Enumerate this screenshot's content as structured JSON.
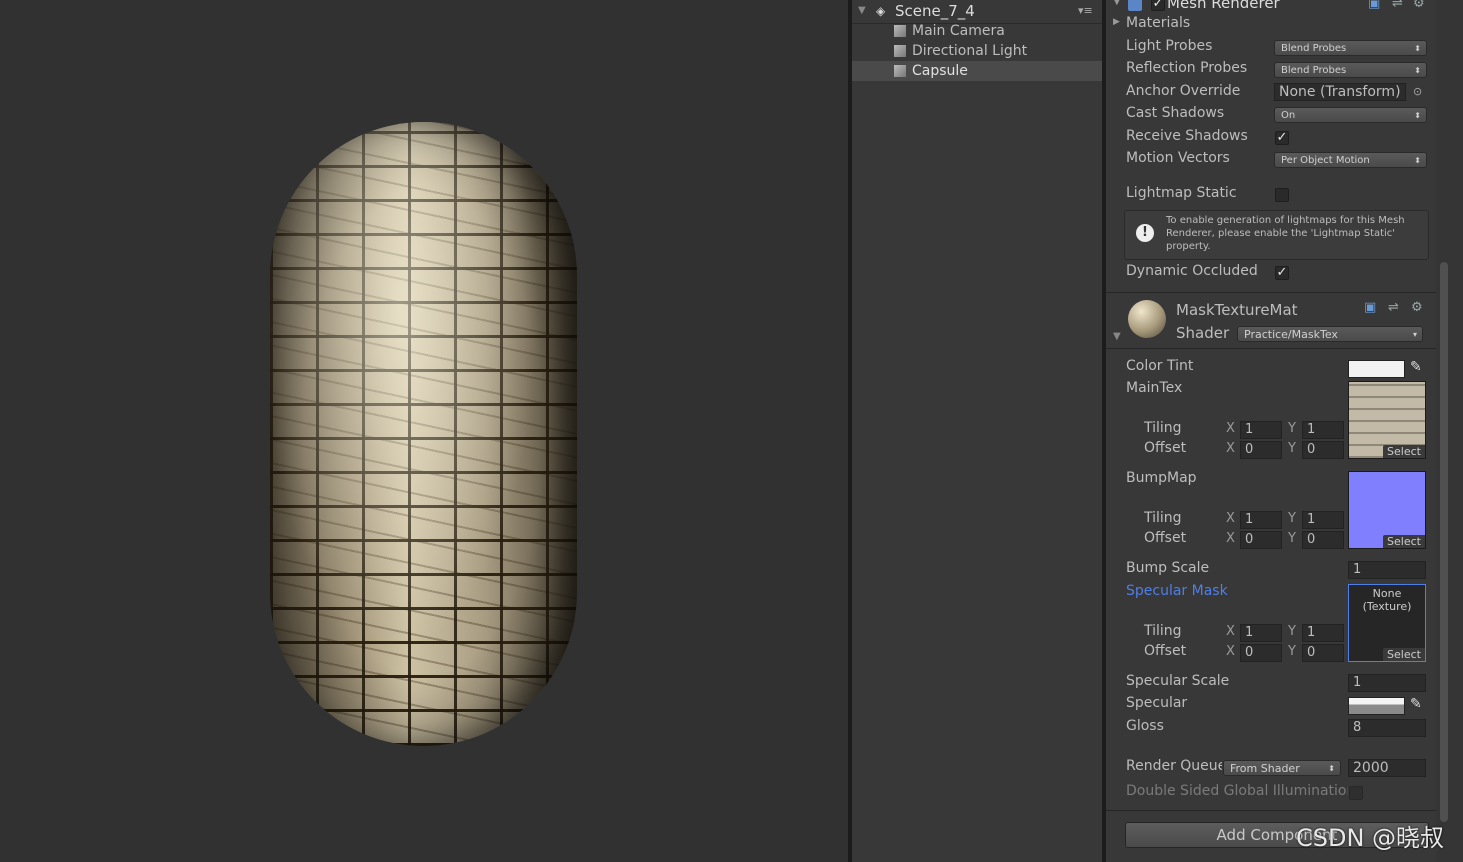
{
  "hierarchy": {
    "scene_name": "Scene_7_4",
    "menu_glyph": "▾≡",
    "items": [
      "Main Camera",
      "Directional Light",
      "Capsule"
    ],
    "selected": "Capsule"
  },
  "mesh_renderer": {
    "title": "Mesh Renderer",
    "materials_label": "Materials",
    "light_probes": {
      "label": "Light Probes",
      "value": "Blend Probes"
    },
    "reflection_probes": {
      "label": "Reflection Probes",
      "value": "Blend Probes"
    },
    "anchor_override": {
      "label": "Anchor Override",
      "value": "None (Transform)"
    },
    "cast_shadows": {
      "label": "Cast Shadows",
      "value": "On"
    },
    "receive_shadows": {
      "label": "Receive Shadows",
      "checked": true
    },
    "motion_vectors": {
      "label": "Motion Vectors",
      "value": "Per Object Motion"
    },
    "lightmap_static": {
      "label": "Lightmap Static",
      "checked": false
    },
    "info_message": "To enable generation of lightmaps for this Mesh Renderer, please enable the 'Lightmap Static' property.",
    "dynamic_occluded": {
      "label": "Dynamic Occluded",
      "checked": true
    }
  },
  "material": {
    "name": "MaskTextureMat",
    "shader_label": "Shader",
    "shader_value": "Practice/MaskTex",
    "color_tint_label": "Color Tint",
    "main_tex_label": "MainTex",
    "bump_map_label": "BumpMap",
    "bump_scale": {
      "label": "Bump Scale",
      "value": "1"
    },
    "specular_mask_label": "Specular Mask",
    "specular_mask_texture": "None\n(Texture)",
    "specular_scale": {
      "label": "Specular Scale",
      "value": "1"
    },
    "specular_label": "Specular",
    "gloss": {
      "label": "Gloss",
      "value": "8"
    },
    "tiling_label": "Tiling",
    "offset_label": "Offset",
    "x_label": "X",
    "y_label": "Y",
    "tiling_x": "1",
    "tiling_y": "1",
    "offset_x": "0",
    "offset_y": "0",
    "select_label": "Select",
    "render_queue": {
      "label": "Render Queue",
      "mode": "From Shader",
      "value": "2000"
    },
    "double_sided_gi": {
      "label": "Double Sided Global Illumination",
      "checked": false
    }
  },
  "add_component_label": "Add Component",
  "watermark": "CSDN @晓叔",
  "colors": {
    "accent_link": "#4f7fe6",
    "bump_map": "#8080ff",
    "color_tint": "#f2f2f2"
  }
}
